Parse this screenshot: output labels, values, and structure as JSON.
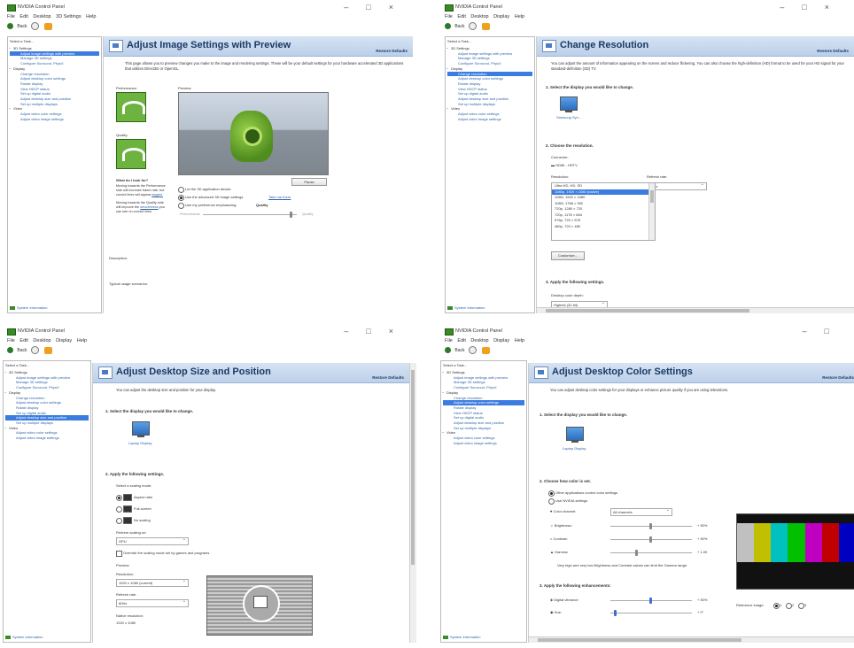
{
  "common": {
    "title": "NVIDIA Control Panel",
    "menu": [
      "File",
      "Edit",
      "Desktop",
      "3D Settings",
      "Help"
    ],
    "menu_alt": [
      "File",
      "Edit",
      "Desktop",
      "Display",
      "Help"
    ],
    "back": "Back",
    "select_task": "Select a Task...",
    "restore": "Restore Defaults",
    "system_info": "System Information",
    "tree": {
      "cat_3d": "3D Settings",
      "adjust_image": "Adjust image settings with preview",
      "manage_3d": "Manage 3D settings",
      "surround": "Configure Surround, PhysX",
      "cat_display": "Display",
      "change_res": "Change resolution",
      "color": "Adjust desktop color settings",
      "rotate": "Rotate display",
      "hdcp": "View HDCP status",
      "audio": "Set up digital audio",
      "size_pos": "Adjust desktop size and position",
      "multi": "Set up multiple displays",
      "cat_video": "Video",
      "video_color": "Adjust video color settings",
      "video_image": "Adjust video image settings"
    }
  },
  "w1": {
    "heading": "Adjust Image Settings with Preview",
    "desc": "This page allows you to preview changes you make to the image and rendering settings. These will be your default settings for your hardware accelerated 3D applications that utilizes Direct3D or OpenGL.",
    "performance": "Performance:",
    "quality": "Quality:",
    "preview": "Preview:",
    "look_for": "What do I look for?",
    "look_text1": "Moving towards the Performance side will increase frame rate, but curved lines will appear",
    "jagged": "jagged.",
    "look_text2": "Moving towards the Quality side will improve the",
    "smoothness": "smoothness",
    "look_text3": "you can see on curved lines.",
    "pause": "Pause",
    "opt1": "Let the 3D application decide",
    "opt2": "Use the advanced 3D image settings",
    "take_me": "Take me there",
    "opt3": "Use my preference emphasizing:",
    "emph": "Quality",
    "slider_perf": "Performance",
    "slider_qual": "Quality",
    "description": "Description:",
    "usage": "Typical usage scenarios:"
  },
  "w2": {
    "heading": "Change Resolution",
    "desc": "You can adjust the amount of information appearing on the screen and reduce flickering. You can also choose the high-definition (HD) format to be used for your HD signal for your standard-definition (SD) TV.",
    "s1": "1. Select the display you would like to change.",
    "display": "Samsung Syn...",
    "s2": "2. Choose the resolution.",
    "connector": "Connector:",
    "conn_val": "HDMI - HDTV",
    "resolution": "Resolution:",
    "refresh": "Refresh rate:",
    "refresh_val": "60Hz",
    "res_list": [
      "Ultra HD, HD, SD",
      "1080p, 1920 × 1080 (native)",
      "1080i, 1920 × 1080",
      "1080i, 1768 × 992",
      "720p, 1280 × 720",
      "720p, 1176 × 664",
      "576p, 720 × 576",
      "480p, 720 × 480"
    ],
    "customize": "Customize...",
    "s3": "3. Apply the following settings.",
    "depth": "Desktop color depth:",
    "depth_val": "Highest (32-bit)"
  },
  "w3": {
    "heading": "Adjust Desktop Size and Position",
    "desc": "You can adjust the desktop size and position for your display.",
    "s1": "1. Select the display you would like to change.",
    "display": "Laptop Display",
    "s2": "2. Apply the following settings.",
    "mode": "Select a scaling mode:",
    "aspect": "Aspect ratio",
    "full": "Full-screen",
    "noscale": "No scaling",
    "perform_on": "Perform scaling on:",
    "gpu": "GPU",
    "override": "Override the scaling mode set by games and programs",
    "preview": "Preview:",
    "resolution": "Resolution:",
    "res_val": "1920 x 1080 (current)",
    "refresh": "Refresh rate:",
    "refresh_val": "60Hz",
    "native": "Native resolution:",
    "native_val": "1920 x 1080"
  },
  "w4": {
    "heading": "Adjust Desktop Color Settings",
    "desc": "You can adjust desktop color settings for your displays or enhance picture quality if you are using televisions.",
    "s1": "1. Select the display you would like to change.",
    "display": "Laptop Display",
    "s2": "2. Choose how color is set.",
    "other": "Other applications control color settings",
    "nvidia": "Use NVIDIA settings",
    "channel": "Color channel:",
    "channel_val": "All channels",
    "brightness": "Brightness:",
    "brightness_val": "+ 50%",
    "contrast": "Contrast:",
    "contrast_val": "+ 50%",
    "gamma": "Gamma:",
    "gamma_val": "+ 1.00",
    "note": "Very high and very low Brightness and Contrast values can limit the Gamma range.",
    "s3": "3. Apply the following enhancements:",
    "vibrance": "Digital vibrance:",
    "vibrance_val": "+ 50%",
    "hue": "Hue:",
    "hue_val": "+ 0°",
    "ref_image": "Reference image:",
    "ref1": "1",
    "ref2": "2",
    "ref3": "3"
  },
  "colors": {
    "accent": "#3b7ce0",
    "nvidia_green": "#76b900",
    "header_blue": "#1a3a66",
    "link": "#2f65a8"
  },
  "color_bars": [
    "#c0c0c0",
    "#c0c000",
    "#00c0c0",
    "#00c000",
    "#c000c0",
    "#c00000",
    "#0000c0"
  ]
}
